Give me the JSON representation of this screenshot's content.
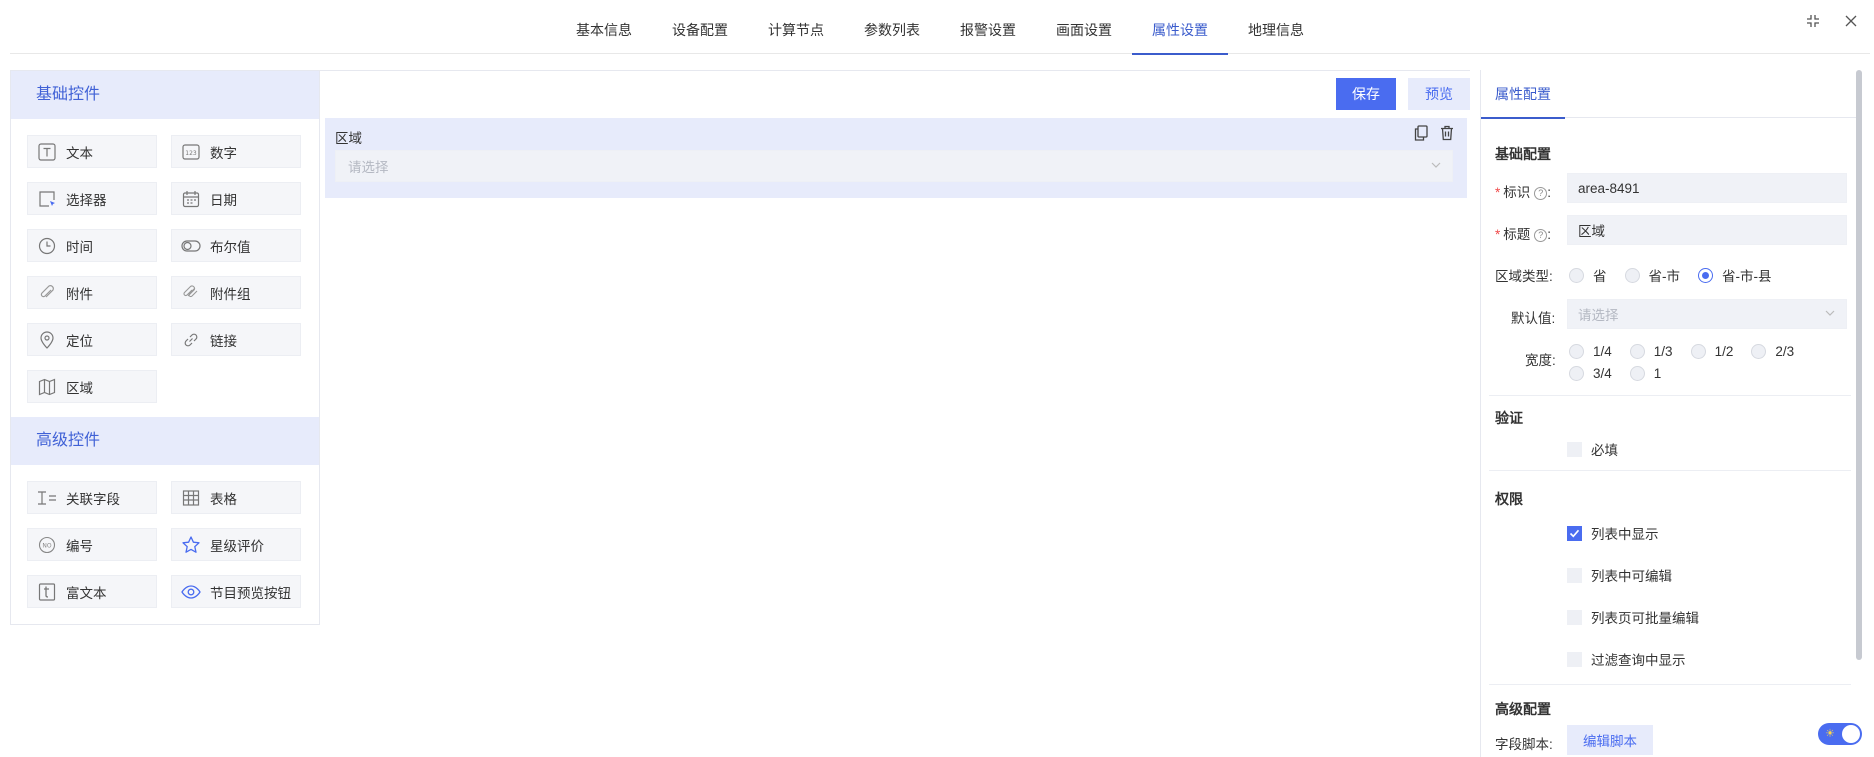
{
  "tabs": [
    {
      "label": "基本信息",
      "active": false
    },
    {
      "label": "设备配置",
      "active": false
    },
    {
      "label": "计算节点",
      "active": false
    },
    {
      "label": "参数列表",
      "active": false
    },
    {
      "label": "报警设置",
      "active": false
    },
    {
      "label": "画面设置",
      "active": false
    },
    {
      "label": "属性设置",
      "active": true
    },
    {
      "label": "地理信息",
      "active": false
    }
  ],
  "window_icons": {
    "shrink": "shrink-icon",
    "close": "close-icon"
  },
  "left": {
    "basic_title": "基础控件",
    "basic": [
      {
        "label": "文本",
        "icon": "text-icon"
      },
      {
        "label": "数字",
        "icon": "number-icon"
      },
      {
        "label": "选择器",
        "icon": "selector-icon"
      },
      {
        "label": "日期",
        "icon": "calendar-icon"
      },
      {
        "label": "时间",
        "icon": "clock-icon"
      },
      {
        "label": "布尔值",
        "icon": "toggle-icon"
      },
      {
        "label": "附件",
        "icon": "paperclip-icon"
      },
      {
        "label": "附件组",
        "icon": "paperclip-group-icon"
      },
      {
        "label": "定位",
        "icon": "location-pin-icon"
      },
      {
        "label": "链接",
        "icon": "link-icon"
      },
      {
        "label": "区域",
        "icon": "map-icon"
      }
    ],
    "advanced_title": "高级控件",
    "advanced": [
      {
        "label": "关联字段",
        "icon": "related-field-icon"
      },
      {
        "label": "表格",
        "icon": "table-icon"
      },
      {
        "label": "编号",
        "icon": "number-badge-icon"
      },
      {
        "label": "星级评价",
        "icon": "star-icon"
      },
      {
        "label": "富文本",
        "icon": "rich-text-icon"
      },
      {
        "label": "节目预览按钮",
        "icon": "eye-icon"
      }
    ]
  },
  "center": {
    "save": "保存",
    "preview": "预览",
    "field_label": "区域",
    "field_placeholder": "请选择",
    "copy_icon": "copy-icon",
    "delete_icon": "trash-icon"
  },
  "right": {
    "tab": "属性配置",
    "basic_section": "基础配置",
    "id_label": "标识",
    "id_value": "area-8491",
    "title_label": "标题",
    "title_value": "区域",
    "help_glyph": "?",
    "colon": ":",
    "required_mark": "*",
    "region_type_label": "区域类型:",
    "region_types": [
      {
        "label": "省",
        "checked": false
      },
      {
        "label": "省-市",
        "checked": false
      },
      {
        "label": "省-市-县",
        "checked": true
      }
    ],
    "default_label": "默认值:",
    "default_placeholder": "请选择",
    "width_label": "宽度:",
    "widths_row1": [
      {
        "label": "1/4",
        "checked": false
      },
      {
        "label": "1/3",
        "checked": false
      },
      {
        "label": "1/2",
        "checked": false
      },
      {
        "label": "2/3",
        "checked": false
      }
    ],
    "widths_row2": [
      {
        "label": "3/4",
        "checked": false
      },
      {
        "label": "1",
        "checked": false
      }
    ],
    "validate_section": "验证",
    "required_label": "必填",
    "required_checked": false,
    "permission_section": "权限",
    "permissions": [
      {
        "label": "列表中显示",
        "checked": true
      },
      {
        "label": "列表中可编辑",
        "checked": false
      },
      {
        "label": "列表页可批量编辑",
        "checked": false
      },
      {
        "label": "过滤查询中显示",
        "checked": false
      }
    ],
    "advanced_section": "高级配置",
    "script_label": "字段脚本:",
    "script_button": "编辑脚本"
  },
  "colors": {
    "accent": "#4a6cf0",
    "accent_light": "#e7ebfb",
    "required": "#f04b4b"
  }
}
